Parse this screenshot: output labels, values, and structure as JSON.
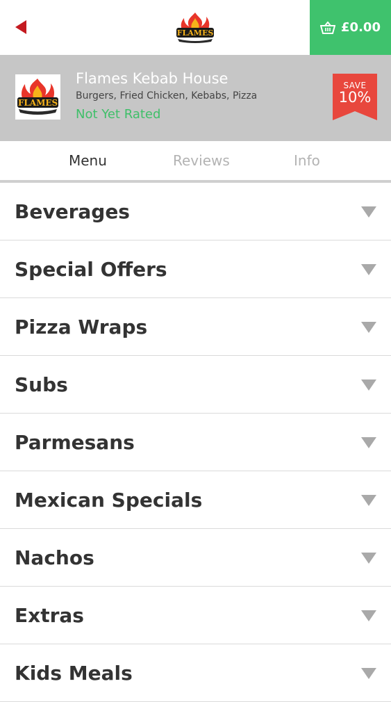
{
  "header": {
    "back_icon": "back-arrow-icon",
    "logo_text": "FLAMES",
    "basket": {
      "icon": "basket-icon",
      "amount": "£0.00",
      "color": "#3fc26d"
    }
  },
  "restaurant": {
    "name": "Flames Kebab House",
    "cuisines": "Burgers, Fried Chicken, Kebabs, Pizza",
    "rating": "Not Yet Rated",
    "logo_text": "FLAMES",
    "badge": {
      "label": "SAVE",
      "value": "10%",
      "color": "#e8473d"
    }
  },
  "tabs": [
    {
      "label": "Menu",
      "active": true
    },
    {
      "label": "Reviews",
      "active": false
    },
    {
      "label": "Info",
      "active": false
    }
  ],
  "menu": {
    "categories": [
      {
        "label": "Beverages"
      },
      {
        "label": "Special Offers"
      },
      {
        "label": "Pizza Wraps"
      },
      {
        "label": "Subs"
      },
      {
        "label": "Parmesans"
      },
      {
        "label": "Mexican Specials"
      },
      {
        "label": "Nachos"
      },
      {
        "label": "Extras"
      },
      {
        "label": "Kids Meals"
      }
    ],
    "expand_icon": "chevron-down-icon"
  },
  "colors": {
    "accent_green": "#3fc26d",
    "brand_red": "#c41a20",
    "header_gray": "#c6c6c6"
  }
}
